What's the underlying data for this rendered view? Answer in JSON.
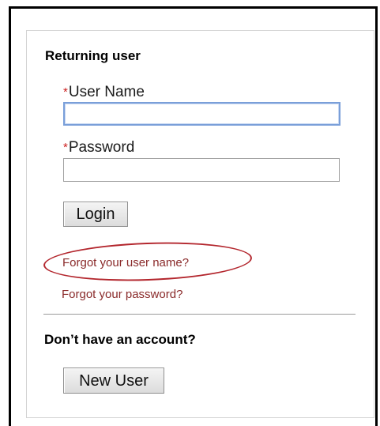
{
  "login": {
    "heading": "Returning user",
    "username": {
      "required_marker": "*",
      "label": "User Name",
      "value": ""
    },
    "password": {
      "required_marker": "*",
      "label": "Password",
      "value": ""
    },
    "login_button": "Login",
    "forgot_username": "Forgot your user name?",
    "forgot_password": "Forgot your password?"
  },
  "signup": {
    "heading": "Don’t have an account?",
    "new_user_button": "New User"
  },
  "annotation": {
    "highlight_color": "#b3262d"
  }
}
